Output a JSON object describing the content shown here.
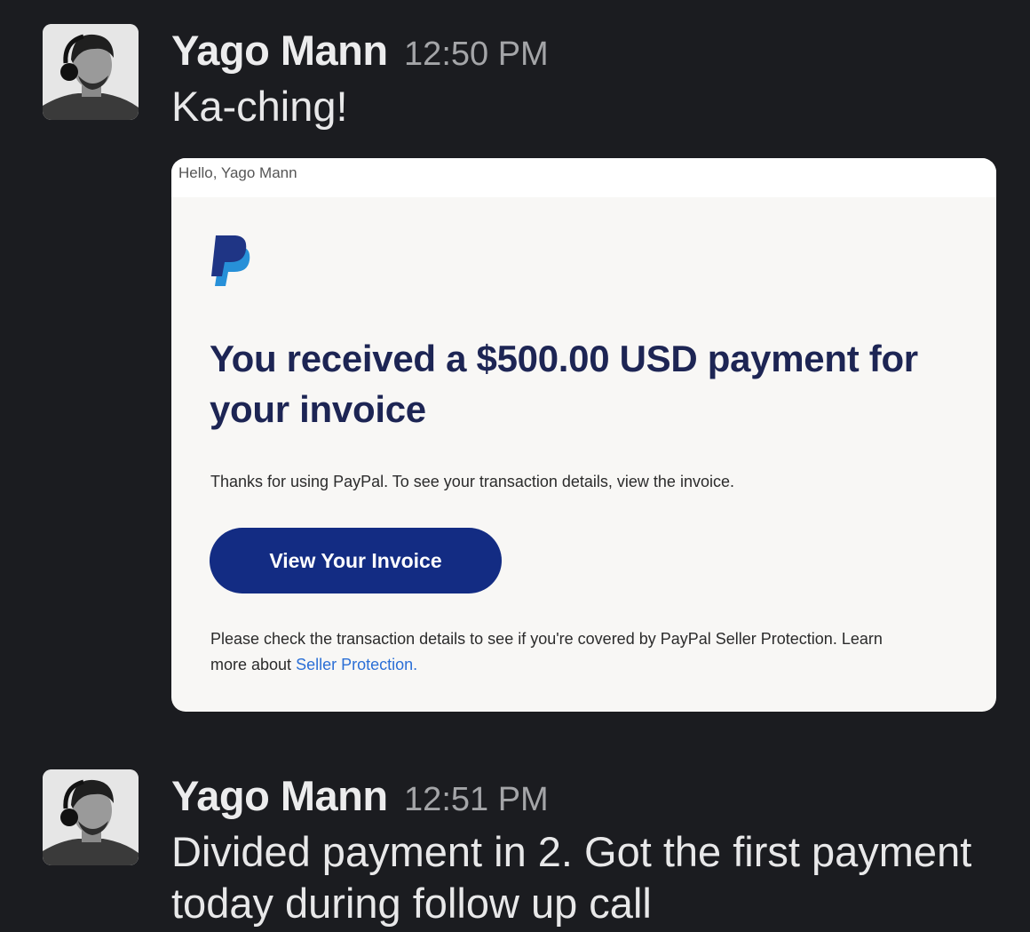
{
  "messages": [
    {
      "author": "Yago Mann",
      "time": "12:50 PM",
      "text": "Ka-ching!",
      "attachment": {
        "greeting": "Hello, Yago Mann",
        "logo_icon": "paypal-logo-icon",
        "heading": "You received a $500.00 USD payment for your invoice",
        "body": "Thanks for using PayPal. To see your transaction details, view the invoice.",
        "button_label": "View Your Invoice",
        "footer_text": "Please check the transaction details to see if you're covered by PayPal Seller Protection. Learn more about",
        "footer_link": "Seller Protection.",
        "colors": {
          "heading": "#1d2554",
          "button": "#132c83",
          "link": "#2b6fd6"
        }
      }
    },
    {
      "author": "Yago Mann",
      "time": "12:51 PM",
      "text": "Divided payment in 2. Got the first payment today during follow up call"
    }
  ]
}
